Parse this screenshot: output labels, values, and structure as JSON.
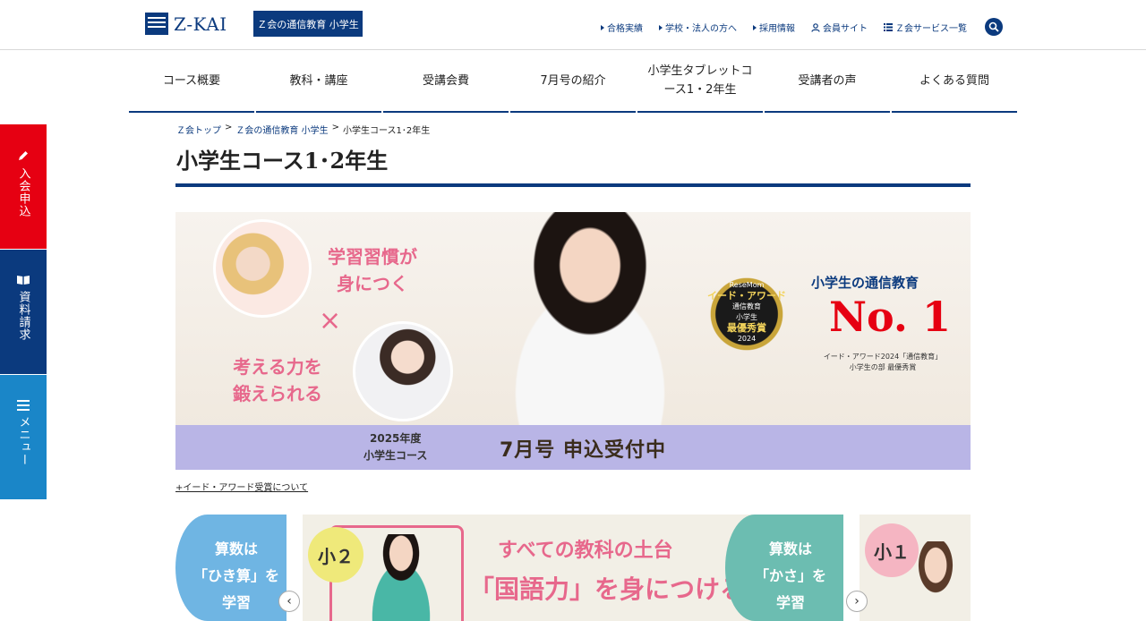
{
  "header": {
    "logo_text": "Z-KAI",
    "service_badge": "Ｚ会の通信教育 小学生",
    "util_links": [
      {
        "label": "合格実績",
        "icon": "triangle-right-icon"
      },
      {
        "label": "学校・法人の方へ",
        "icon": "triangle-right-icon"
      },
      {
        "label": "採用情報",
        "icon": "triangle-right-icon"
      },
      {
        "label": "会員サイト",
        "icon": "user-icon"
      },
      {
        "label": "Ｚ会サービス一覧",
        "icon": "list-icon"
      }
    ]
  },
  "global_nav": [
    {
      "label": "コース概要"
    },
    {
      "label": "教科・講座"
    },
    {
      "label": "受講会費"
    },
    {
      "label": "7月号の紹介"
    },
    {
      "label": "小学生タブレットコース1・2年生"
    },
    {
      "label": "受講者の声"
    },
    {
      "label": "よくある質問"
    }
  ],
  "side_tabs": {
    "apply": {
      "label": "入会申込",
      "icon": "pencil-icon",
      "color": "#e60012"
    },
    "request": {
      "label": "資料請求",
      "icon": "book-icon",
      "color": "#0b3a7e"
    },
    "menu": {
      "label": "メニュー",
      "icon": "hamburger-icon",
      "color": "#1a86c8"
    }
  },
  "breadcrumb": [
    "Ｚ会トップ",
    "Ｚ会の通信教育 小学生",
    "小学生コース1･2年生"
  ],
  "page_title": "小学生コース1･2年生",
  "hero": {
    "habit_text_1": "学習習慣が",
    "habit_text_2": "身につく",
    "times_symbol": "×",
    "think_text_1": "考える力を",
    "think_text_2": "鍛えられる",
    "award_brand": "ReseMom",
    "award_title": "イード・アワード",
    "award_category": "通信教育",
    "award_level": "小学生",
    "award_prize": "最優秀賞",
    "award_year": "2024",
    "no1_caption": "小学生の通信教育",
    "no1": "No. 1",
    "no1_sub_1": "イード・アワード2024「通信教育」",
    "no1_sub_2": "小学生の部 最優秀賞",
    "strip_year_1": "2025年度",
    "strip_year_2": "小学生コース",
    "strip_month": "7月号 申込受付中"
  },
  "award_link": "+イード・アワード受賞について",
  "carousel": {
    "left_slide": {
      "line1": "算数は",
      "line2": "「ひき算」を",
      "line3": "学習"
    },
    "center_slide": {
      "badge": "小２",
      "line1": "すべての教科の土台",
      "line2": "「国語力」を身につける",
      "right_line1": "算数は",
      "right_line2": "「かさ」を",
      "right_line3": "学習"
    },
    "right_slide": {
      "badge": "小１"
    },
    "prev": "‹",
    "next": "›"
  },
  "colors": {
    "brand": "#0b3a7e",
    "accent_red": "#e60012",
    "accent_pink": "#e7688c"
  }
}
